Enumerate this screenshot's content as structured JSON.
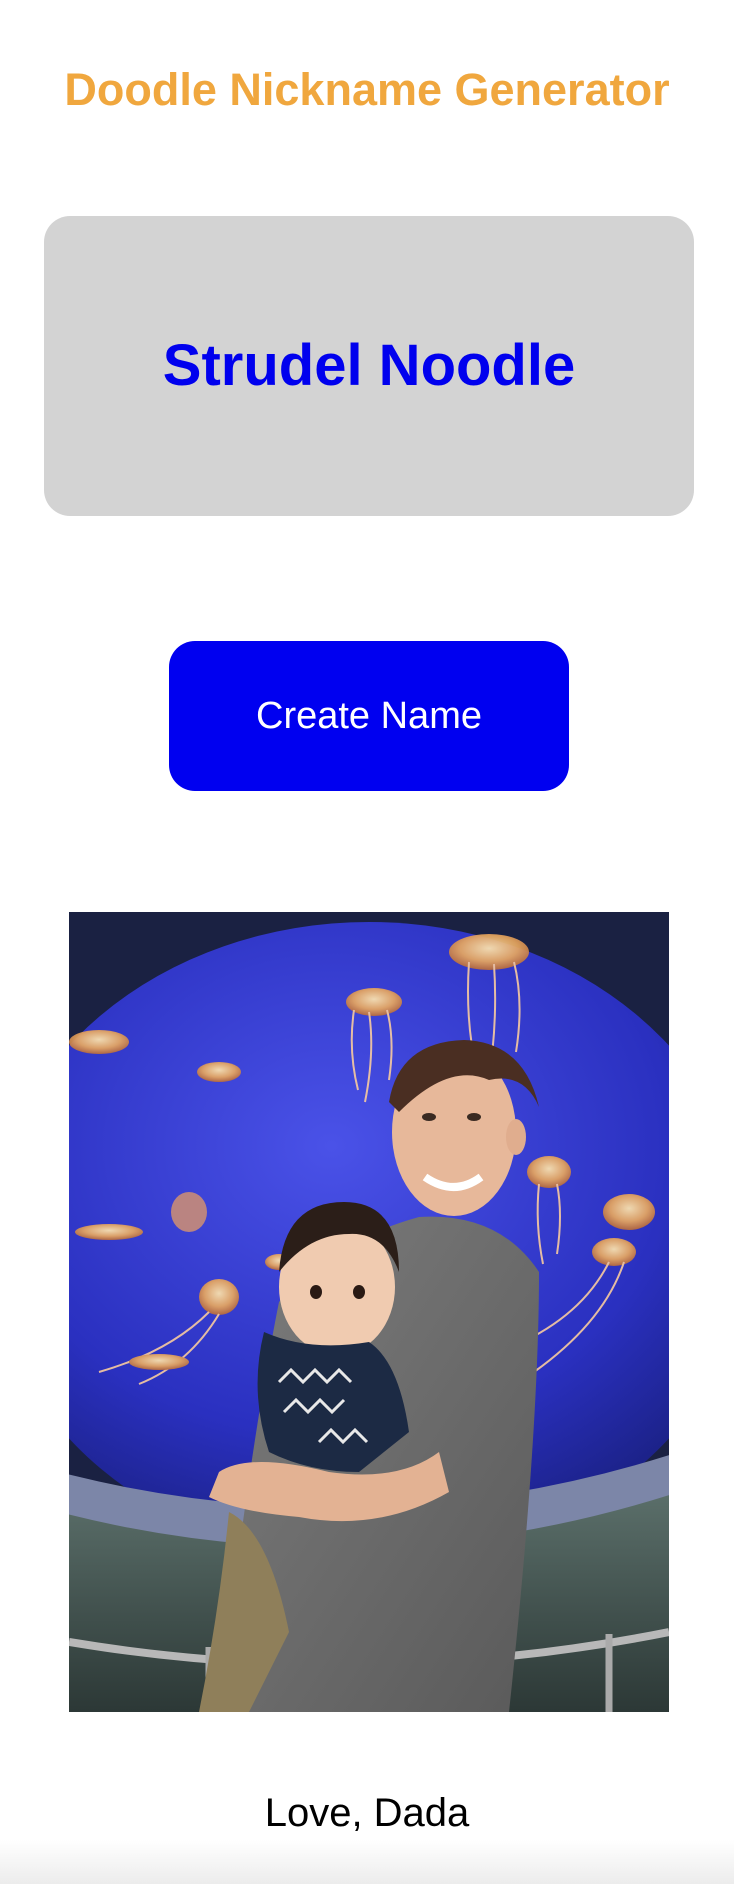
{
  "app": {
    "title": "Doodle Nickname Generator"
  },
  "nickname": {
    "value": "Strudel Noodle"
  },
  "actions": {
    "create_label": "Create Name"
  },
  "photo": {
    "alt": "Father holding a baby in front of a jellyfish aquarium"
  },
  "footer": {
    "signoff": "Love, Dada"
  },
  "colors": {
    "title": "#f0a73e",
    "nickname": "#0000ee",
    "card_background": "#d3d3d3",
    "button_background": "#0000f0",
    "button_text": "#ffffff"
  }
}
